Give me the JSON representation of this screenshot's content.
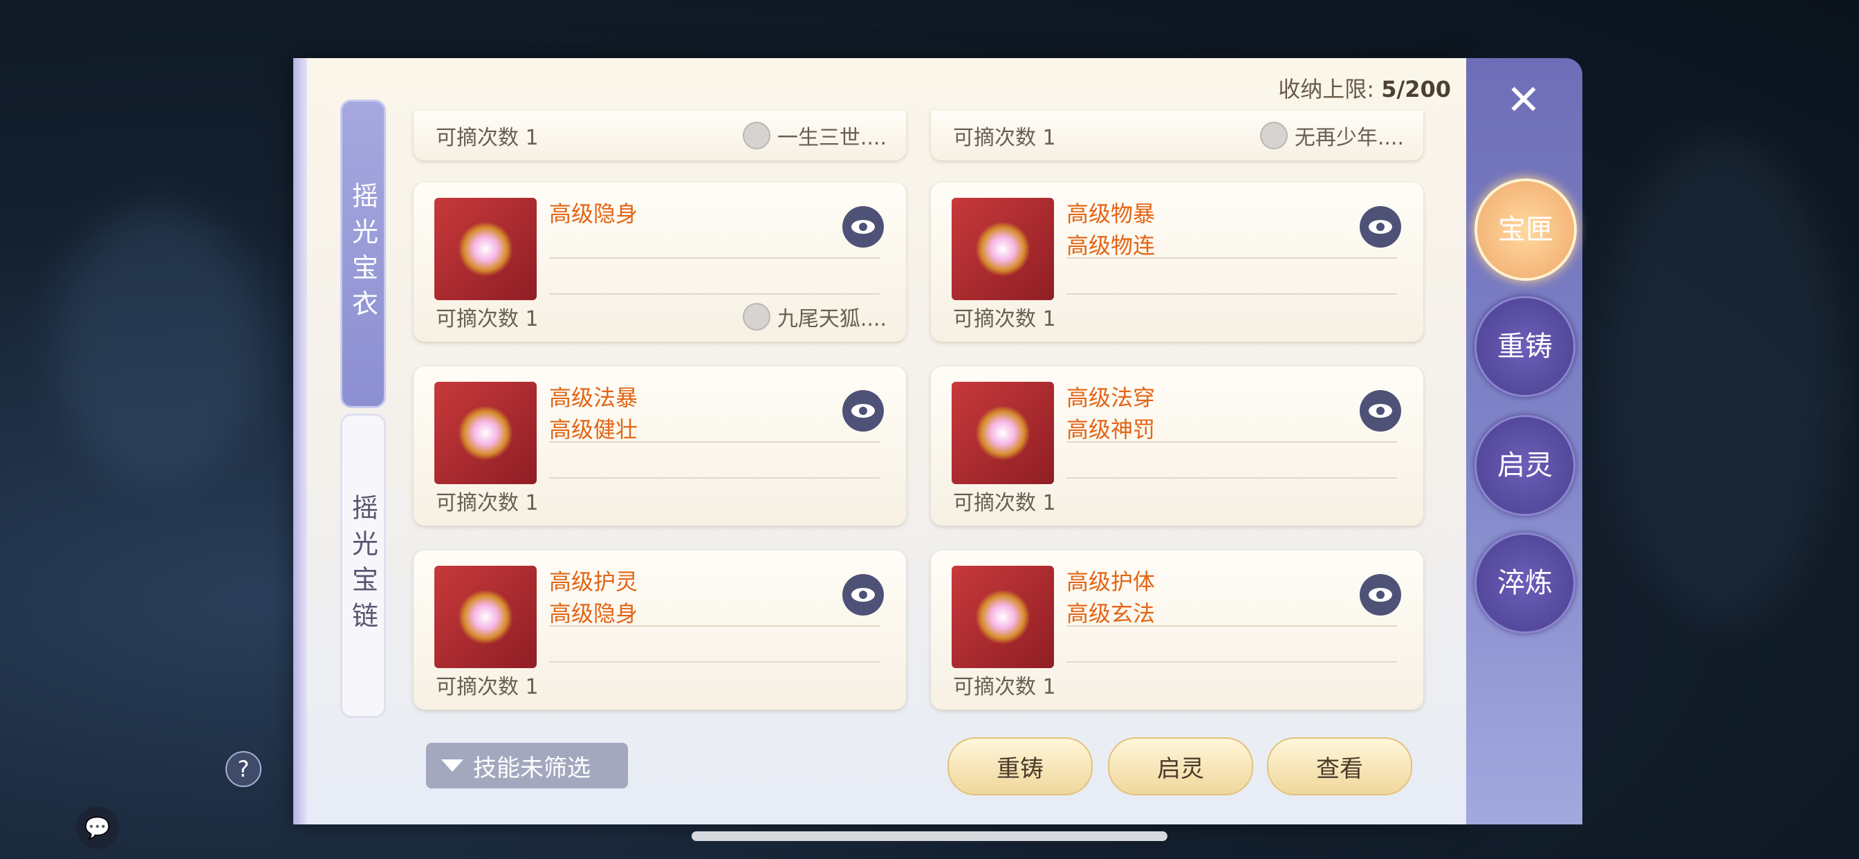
{
  "capacity": {
    "label": "收纳上限:",
    "value": "5/200"
  },
  "side_tabs": [
    {
      "label": "摇光宝衣",
      "active": true
    },
    {
      "label": "摇光宝链",
      "active": false
    }
  ],
  "top_partial_cards": [
    {
      "count": "可摘次数 1",
      "owner": "一生三世...."
    },
    {
      "count": "可摘次数 1",
      "owner": "无再少年...."
    }
  ],
  "cards": [
    {
      "skill1": "高级隐身",
      "skill2": "",
      "count": "可摘次数 1",
      "owner": "九尾天狐...."
    },
    {
      "skill1": "高级物暴",
      "skill2": "高级物连",
      "count": "可摘次数 1",
      "owner": ""
    },
    {
      "skill1": "高级法暴",
      "skill2": "高级健壮",
      "count": "可摘次数 1",
      "owner": ""
    },
    {
      "skill1": "高级法穿",
      "skill2": "高级神罚",
      "count": "可摘次数 1",
      "owner": ""
    },
    {
      "skill1": "高级护灵",
      "skill2": "高级隐身",
      "count": "可摘次数 1",
      "owner": ""
    },
    {
      "skill1": "高级护体",
      "skill2": "高级玄法",
      "count": "可摘次数 1",
      "owner": ""
    }
  ],
  "filter_label": "技能未筛选",
  "actions": {
    "recast": "重铸",
    "awaken": "启灵",
    "view": "查看"
  },
  "nav": [
    {
      "label": "宝匣",
      "active": true
    },
    {
      "label": "重铸",
      "active": false
    },
    {
      "label": "启灵",
      "active": false
    },
    {
      "label": "淬炼",
      "active": false
    }
  ],
  "help_label": "?",
  "colors": {
    "skill_text": "#e26516",
    "panel": "#fbf6ea",
    "nav_bar": "#6d6eb7"
  }
}
